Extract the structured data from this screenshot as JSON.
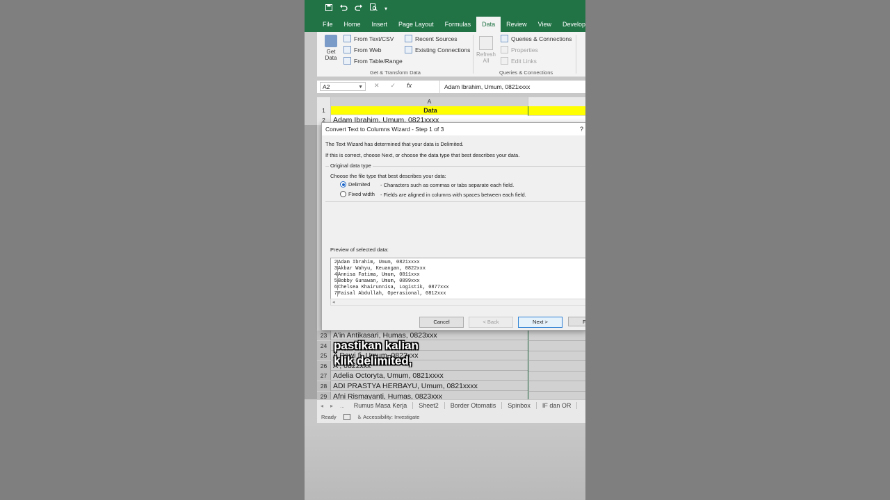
{
  "quick_access": {
    "save_icon": "save-icon",
    "undo_icon": "undo-icon",
    "redo_icon": "redo-icon",
    "preview_icon": "print-preview-icon",
    "customize": "▾"
  },
  "ribbon_tabs": [
    "File",
    "Home",
    "Insert",
    "Page Layout",
    "Formulas",
    "Data",
    "Review",
    "View",
    "Developer"
  ],
  "active_tab": "Data",
  "ribbon": {
    "get_data": "Get Data",
    "from_text_csv": "From Text/CSV",
    "from_web": "From Web",
    "from_table_range": "From Table/Range",
    "recent_sources": "Recent Sources",
    "existing_connections": "Existing Connections",
    "group_get_transform": "Get & Transform Data",
    "refresh_all": "Refresh All",
    "queries_connections": "Queries & Connections",
    "properties": "Properties",
    "edit_links": "Edit Links",
    "group_queries": "Queries & Connections"
  },
  "formula_bar": {
    "name_box": "A2",
    "cancel": "✕",
    "enter": "✓",
    "fx": "fx",
    "content": "Adam Ibrahim, Umum, 0821xxxx"
  },
  "sheet": {
    "column_header": "A",
    "header_row_num": "1",
    "header_cell": "Data",
    "partial_row_num": "2",
    "partial_row_text": "Adam Ibrahim, Umum, 0821xxxx",
    "rows": [
      {
        "num": "23",
        "text": "A'in Antikasari, Humas, 0823xxx"
      },
      {
        "num": "24",
        "text": ""
      },
      {
        "num": "25",
        "text": "A        Dewi      fi, Umum, 0823xxx"
      },
      {
        "num": "26",
        "text": "A                                  , 0822xxx"
      },
      {
        "num": "27",
        "text": "Adelia Octoryta, Umum, 0821xxxx"
      },
      {
        "num": "28",
        "text": "ADI PRASTYA HERBAYU, Umum, 0821xxxx"
      },
      {
        "num": "29",
        "text": "Afni Rismayanti, Humas, 0823xxx"
      }
    ]
  },
  "dialog": {
    "title": "Convert Text to Columns Wizard - Step 1 of 3",
    "help": "?",
    "line1": "The Text Wizard has determined that your data is Delimited.",
    "line2": "If this is correct, choose Next, or choose the data type that best describes your data.",
    "group_label": "Original data type",
    "choose_label": "Choose the file type that best describes your data:",
    "option_delimited": "Delimited",
    "option_delimited_desc": "- Characters such as commas or tabs separate each field.",
    "option_fixed": "Fixed width",
    "option_fixed_desc": "- Fields are aligned in columns with spaces between each field.",
    "preview_label": "Preview of selected data:",
    "preview_lines": [
      {
        "n": "2",
        "text": "Adam Ibrahim, Umum, 0821xxxx"
      },
      {
        "n": "3",
        "text": "Akbar Wahyu, Keuangan, 0822xxx"
      },
      {
        "n": "4",
        "text": "Annisa Fatima, Umum, 0811xxx"
      },
      {
        "n": "5",
        "text": "Bobby Gunawan, Umum, 0899xxx"
      },
      {
        "n": "6",
        "text": "Chelsea Khairunnisa, Logistik, 0877xxx"
      },
      {
        "n": "7",
        "text": "Faisal Abdullah, Operasional, 0812xxx"
      }
    ],
    "scroll_left": "◂",
    "cancel": "Cancel",
    "back": "< Back",
    "next": "Next >",
    "finish": "F"
  },
  "sheet_tabs": {
    "nav_prev": "◂",
    "nav_next": "▸",
    "more": "...",
    "tabs": [
      "Rumus Masa Kerja",
      "Sheet2",
      "Border Otomatis",
      "Spinbox",
      "IF dan OR"
    ]
  },
  "status_bar": {
    "ready": "Ready",
    "accessibility": "Accessibility: Investigate"
  },
  "caption": {
    "line1": "pastikan kalian",
    "line2": "klik delimited,"
  },
  "colors": {
    "excel_green": "#217346",
    "header_yellow": "#ffff00",
    "accent_blue": "#1e66c8"
  }
}
